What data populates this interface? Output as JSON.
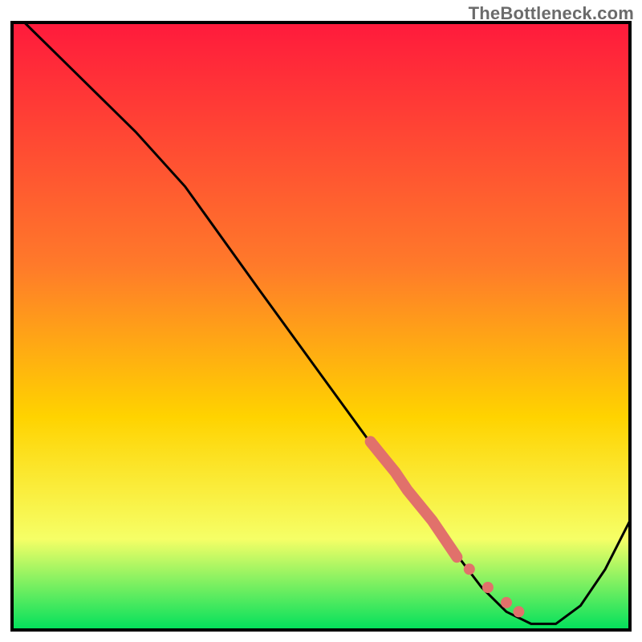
{
  "watermark": "TheBottleneck.com",
  "colors": {
    "gradient_top": "#ff1a3c",
    "gradient_mid1": "#ff7a2a",
    "gradient_mid2": "#ffd300",
    "gradient_mid3": "#f6ff66",
    "gradient_bottom": "#00e05c",
    "frame": "#000000",
    "curve": "#000000",
    "highlight": "#e1716b"
  },
  "chart_data": {
    "type": "line",
    "title": "",
    "xlabel": "",
    "ylabel": "",
    "xlim": [
      0,
      100
    ],
    "ylim": [
      0,
      100
    ],
    "x": [
      2,
      10,
      20,
      28,
      40,
      50,
      55,
      60,
      63,
      66,
      70,
      73,
      76,
      80,
      84,
      88,
      92,
      96,
      100
    ],
    "y": [
      100,
      92,
      82,
      73,
      56,
      42,
      35,
      28,
      24,
      20,
      15,
      11,
      7,
      3,
      1,
      1,
      4,
      10,
      18
    ],
    "highlight_segment": {
      "x": [
        58,
        60,
        62,
        64,
        66,
        68,
        70,
        72
      ],
      "y": [
        31,
        28.5,
        26,
        23,
        20.5,
        18,
        15,
        12
      ]
    },
    "highlight_dots": {
      "x": [
        74,
        77,
        80,
        82
      ],
      "y": [
        10,
        7,
        4.5,
        3
      ]
    }
  }
}
